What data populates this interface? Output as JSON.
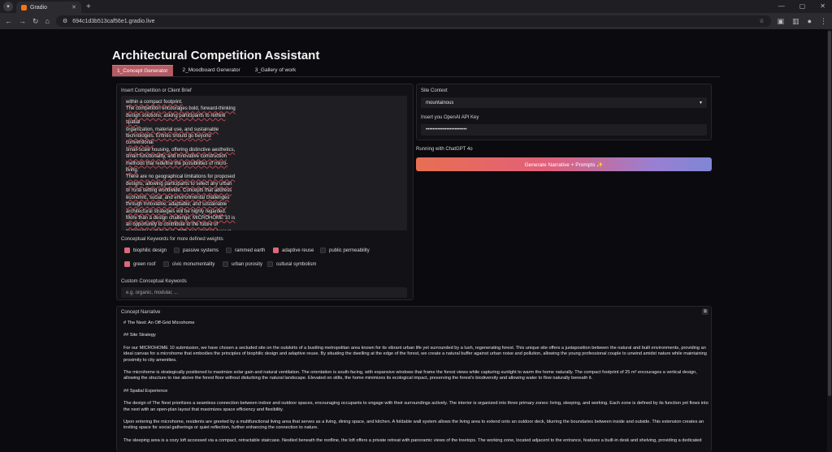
{
  "browser": {
    "tab_title": "Gradio",
    "url": "694c1d3b513caf56e1.gradio.live"
  },
  "app": {
    "title": "Architectural Competition Assistant",
    "tabs": [
      "1_Concept Generator",
      "2_Moodboard Generator",
      "3_Gallery of work"
    ]
  },
  "brief": {
    "label": "Insert Competition or Client Brief",
    "text": "within a compact footprint.\nThe competition encourages bold, forward-thinking\ndesign solutions, asking participants to rethink spatial\norganization, material use, and sustainable\ntechnologies. Entries should go beyond conventional\nsmall-scale housing, offering distinctive aesthetics,\nsmart functionality, and innovative construction\nmethods that redefine the possibilities of micro-living.\nThere are no geographical limitations for proposed\ndesigns, allowing participants to select any urban\nor rural setting worldwide. Concepts that address\neconomic, social, and environmental challenges\nthrough innovative, adaptable, and sustainable\narchitectural strategies will be highly regarded.\nMore than a design challenge, MICROHOME 10 is\nan opportunity to contribute to the future of\nresidential architecture. With one winning project\nset to be built, this edition aims to turn visionary\nideas into real-world solutions, shaping the next\ngeneration of compact, efficient, and sustainable\nhomes."
  },
  "keywords": {
    "label": "Conceptual Keywords for more defined weights",
    "row1": [
      {
        "label": "biophilic design",
        "checked": true
      },
      {
        "label": "passive systems",
        "checked": false
      },
      {
        "label": "rammed earth",
        "checked": false
      },
      {
        "label": "adaptive reuse",
        "checked": true
      },
      {
        "label": "public permeability",
        "checked": false
      }
    ],
    "row2": [
      {
        "label": "green roof",
        "checked": true
      },
      {
        "label": "civic monumentality",
        "checked": false
      },
      {
        "label": "urban porosity",
        "checked": false
      },
      {
        "label": "cultural symbolism",
        "checked": false
      }
    ]
  },
  "custom": {
    "label": "Custom Conceptual Keywords",
    "placeholder": "e.g. organic, modular, ..."
  },
  "site": {
    "label": "Site Context",
    "value": "mountainous",
    "api_label": "Insert you OpenAI API Key",
    "api_value": "••••••••••••••••••••••••"
  },
  "running": "Running with ChatGPT 4o",
  "generate_label": "Generate Narrative + Prompts ✨",
  "narrative": {
    "label": "Concept Narrative",
    "paragraphs": [
      "# The Nest: An Off-Grid Microhome",
      "## Site Strategy",
      "For our MICROHOME 10 submission, we have chosen a secluded site on the outskirts of a bustling metropolitan area known for its vibrant urban life yet surrounded by a lush, regenerating forest. This unique site offers a juxtaposition between the natural and built environments, providing an ideal canvas for a microhome that embodies the principles of biophilic design and adaptive reuse. By situating the dwelling at the edge of the forest, we create a natural buffer against urban noise and pollution, allowing the young professional couple to unwind amidst nature while maintaining proximity to city amenities.",
      "The microhome is strategically positioned to maximize solar gain and natural ventilation. The orientation is south-facing, with expansive windows that frame the forest views while capturing sunlight to warm the home naturally. The compact footprint of 25 m² encourages a vertical design, allowing the structure to rise above the forest floor without disturbing the natural landscape. Elevated on stilts, the home minimizes its ecological impact, preserving the forest's biodiversity and allowing water to flow naturally beneath it.",
      "## Spatial Experience",
      "The design of The Nest prioritizes a seamless connection between indoor and outdoor spaces, encouraging occupants to engage with their surroundings actively. The interior is organized into three primary zones: living, sleeping, and working. Each zone is defined by its function yet flows into the next with an open-plan layout that maximizes space efficiency and flexibility.",
      "Upon entering the microhome, residents are greeted by a multifunctional living area that serves as a living, dining space, and kitchen. A foldable wall system allows the living area to extend onto an outdoor deck, blurring the boundaries between inside and outside. This extension creates an inviting space for social gatherings or quiet reflection, further enhancing the connection to nature.",
      "The sleeping area is a cozy loft accessed via a compact, retractable staircase. Nestled beneath the roofline, the loft offers a private retreat with panoramic views of the treetops. The working zone, located adjacent to the entrance, features a built-in desk and shelving, providing a dedicated"
    ]
  }
}
